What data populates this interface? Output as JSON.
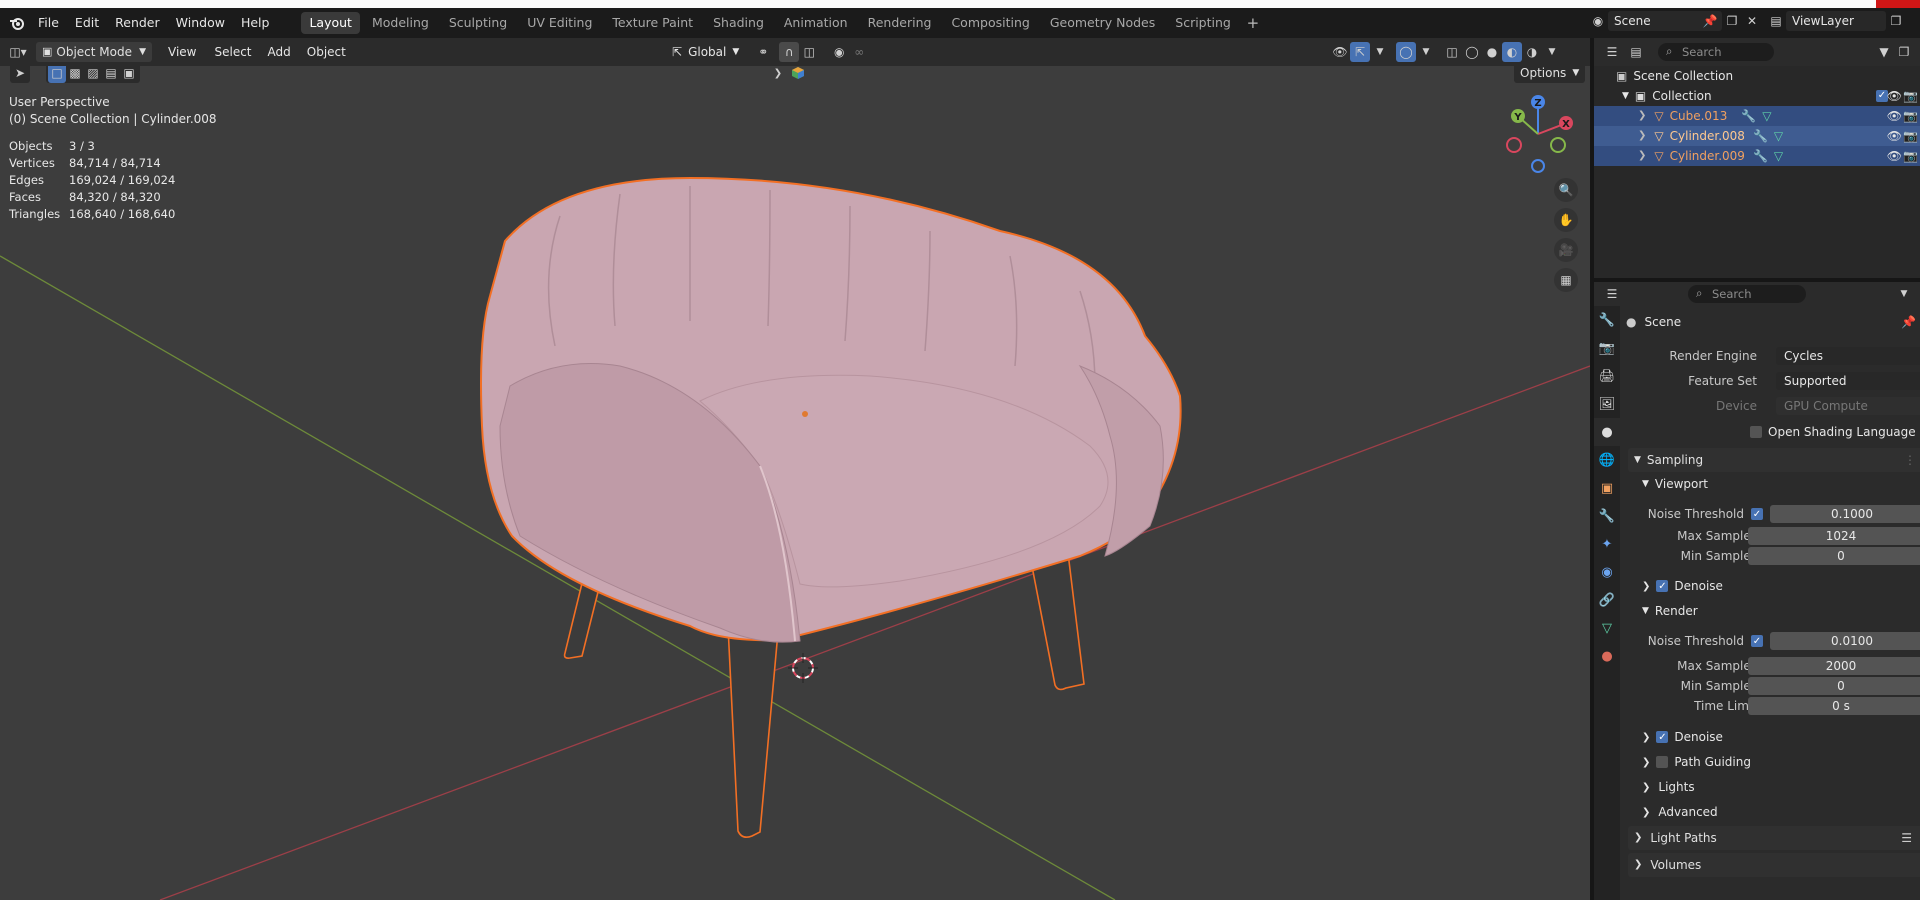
{
  "menubar": {
    "menus": [
      "File",
      "Edit",
      "Render",
      "Window",
      "Help"
    ],
    "workspaces": [
      "Layout",
      "Modeling",
      "Sculpting",
      "UV Editing",
      "Texture Paint",
      "Shading",
      "Animation",
      "Rendering",
      "Compositing",
      "Geometry Nodes",
      "Scripting"
    ],
    "active_workspace": "Layout",
    "scene": "Scene",
    "view_layer": "ViewLayer"
  },
  "viewport_header": {
    "mode": "Object Mode",
    "menus": [
      "View",
      "Select",
      "Add",
      "Object"
    ],
    "transform_orientation": "Global",
    "options": "Options"
  },
  "viewport": {
    "perspective": "User Perspective",
    "collection_info": "(0) Scene Collection | Cylinder.008",
    "stats": [
      {
        "label": "Objects",
        "value": "3 / 3"
      },
      {
        "label": "Vertices",
        "value": "84,714 / 84,714"
      },
      {
        "label": "Edges",
        "value": "169,024 / 169,024"
      },
      {
        "label": "Faces",
        "value": "84,320 / 84,320"
      },
      {
        "label": "Triangles",
        "value": "168,640 / 168,640"
      }
    ],
    "axes": {
      "x": "X",
      "y": "Y",
      "z": "Z"
    }
  },
  "outliner": {
    "search_placeholder": "Search",
    "root": "Scene Collection",
    "collection": "Collection",
    "objects": [
      "Cube.013",
      "Cylinder.008",
      "Cylinder.009"
    ],
    "active_object": "Cylinder.008"
  },
  "properties": {
    "search_placeholder": "Search",
    "context": "Scene",
    "render_engine_label": "Render Engine",
    "render_engine": "Cycles",
    "feature_set_label": "Feature Set",
    "feature_set": "Supported",
    "device_label": "Device",
    "device": "GPU Compute",
    "osl": "Open Shading Language",
    "sampling": "Sampling",
    "viewport": {
      "title": "Viewport",
      "noise_threshold_label": "Noise Threshold",
      "noise_threshold": "0.1000",
      "max_samples_label": "Max Samples",
      "max_samples": "1024",
      "min_samples_label": "Min Samples",
      "min_samples": "0",
      "denoise": "Denoise"
    },
    "render": {
      "title": "Render",
      "noise_threshold_label": "Noise Threshold",
      "noise_threshold": "0.0100",
      "max_samples_label": "Max Samples",
      "max_samples": "2000",
      "min_samples_label": "Min Samples",
      "min_samples": "0",
      "time_limit_label": "Time Limit",
      "time_limit": "0 s",
      "denoise": "Denoise"
    },
    "path_guiding": "Path Guiding",
    "lights": "Lights",
    "advanced": "Advanced",
    "light_paths": "Light Paths",
    "volumes": "Volumes"
  },
  "colors": {
    "accent": "#4772b3",
    "selection_outline": "#f26f24",
    "chair_fabric": "#c9a6b1",
    "chair_legs": "#3a3a3a",
    "x_axis": "#d9475e",
    "y_axis": "#86b84a",
    "z_axis": "#4a86e8"
  }
}
